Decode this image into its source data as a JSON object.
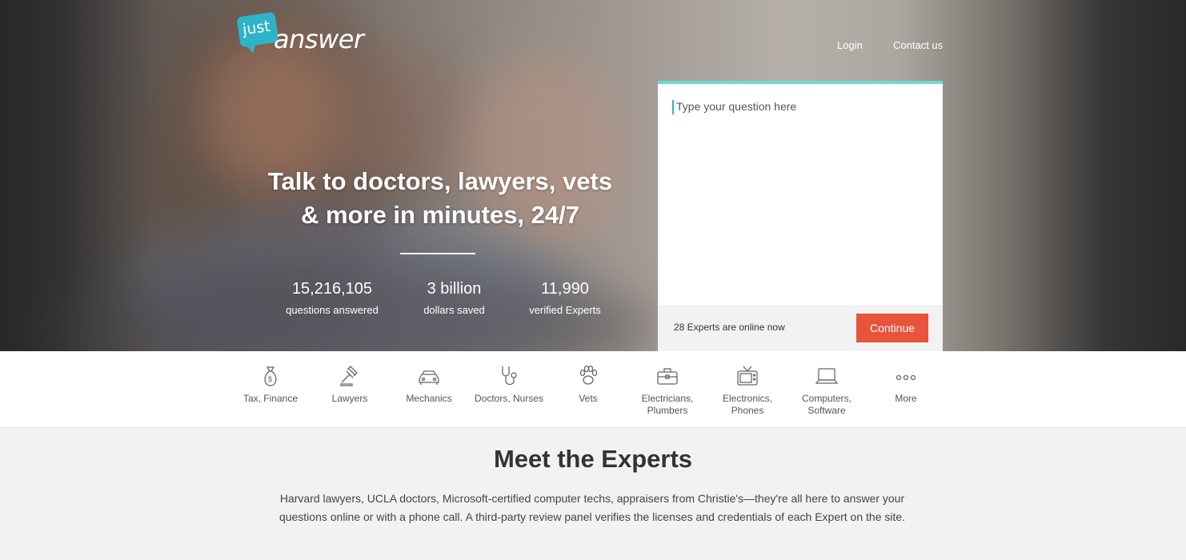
{
  "brand": {
    "logo_small": "just",
    "logo_large": "answer"
  },
  "nav": {
    "login": "Login",
    "contact": "Contact us"
  },
  "hero": {
    "headline_line1": "Talk to doctors, lawyers, vets",
    "headline_line2": "& more in minutes, 24/7",
    "stats": [
      {
        "value": "15,216,105",
        "label": "questions answered"
      },
      {
        "value": "3 billion",
        "label": "dollars saved"
      },
      {
        "value": "11,990",
        "label": "verified Experts"
      }
    ]
  },
  "question_box": {
    "placeholder": "Type your question here",
    "online_text": "28 Experts are online now",
    "continue_label": "Continue",
    "accent_color": "#6fd9cf",
    "button_color": "#e8533c"
  },
  "categories": [
    {
      "label": "Tax, Finance",
      "icon": "money-bag-icon"
    },
    {
      "label": "Lawyers",
      "icon": "gavel-icon"
    },
    {
      "label": "Mechanics",
      "icon": "car-icon"
    },
    {
      "label": "Doctors, Nurses",
      "icon": "stethoscope-icon"
    },
    {
      "label": "Vets",
      "icon": "paw-icon"
    },
    {
      "label": "Electricians, Plumbers",
      "icon": "toolbox-icon"
    },
    {
      "label": "Electronics, Phones",
      "icon": "tv-icon"
    },
    {
      "label": "Computers, Software",
      "icon": "laptop-icon"
    },
    {
      "label": "More",
      "icon": "more-dots-icon"
    }
  ],
  "meet": {
    "title": "Meet the Experts",
    "text": "Harvard lawyers, UCLA doctors, Microsoft-certified computer techs, appraisers from Christie's—they're all here to answer your questions online or with a phone call. A third-party review panel verifies the licenses and credentials of each Expert on the site."
  }
}
